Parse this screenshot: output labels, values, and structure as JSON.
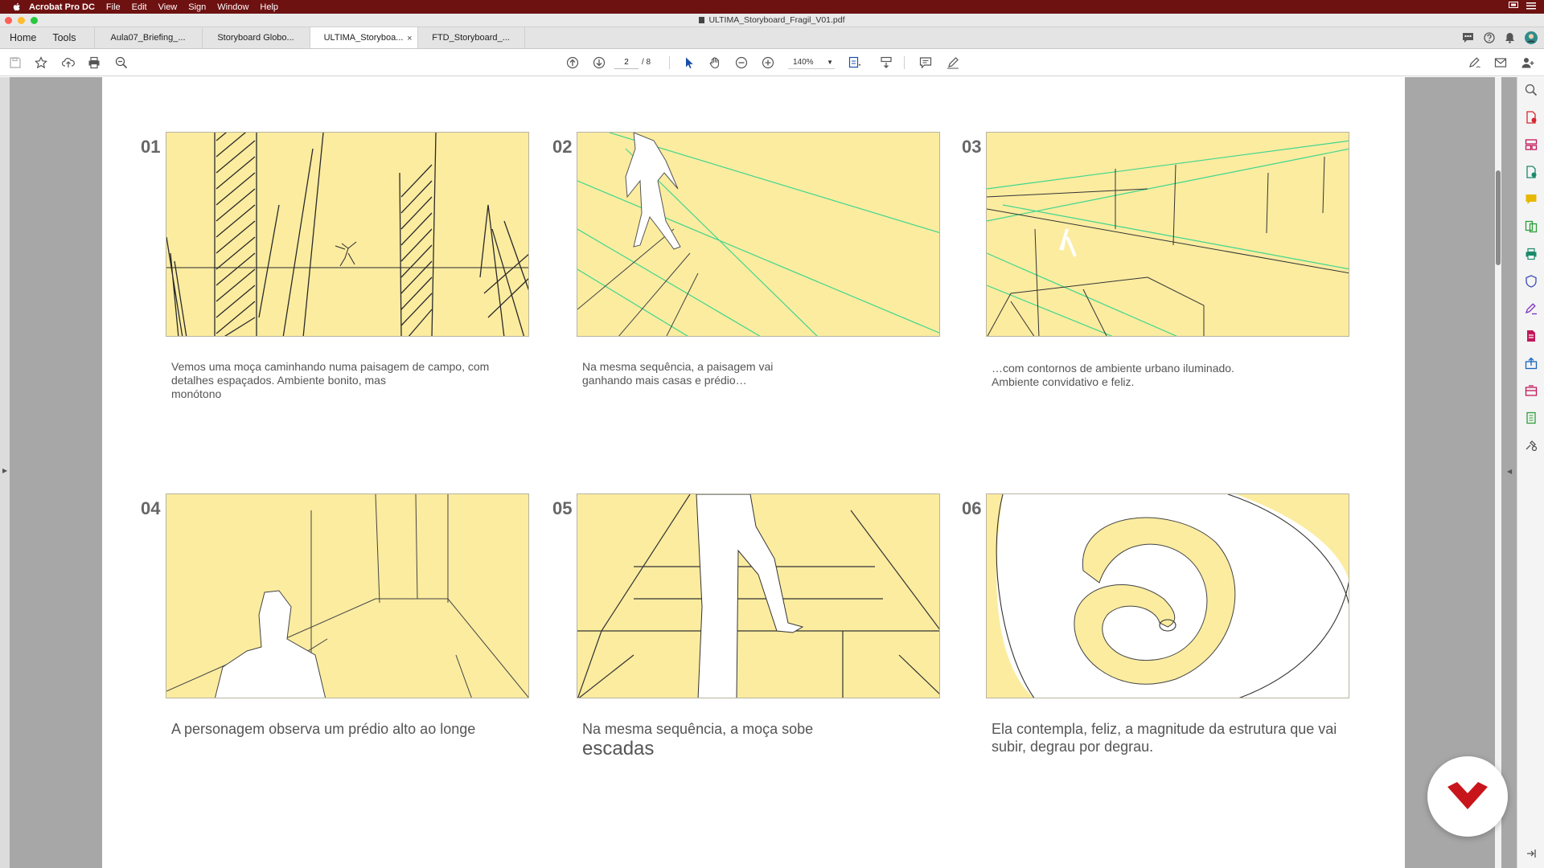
{
  "menubar": {
    "app_name": "Acrobat Pro DC",
    "menus": [
      "File",
      "Edit",
      "View",
      "Sign",
      "Window",
      "Help"
    ]
  },
  "window": {
    "title": "ULTIMA_Storyboard_Fragil_V01.pdf"
  },
  "tabs": {
    "home_label": "Home",
    "tools_label": "Tools",
    "documents": [
      {
        "label": "Aula07_Briefing_..."
      },
      {
        "label": "Storyboard Globo..."
      },
      {
        "label": "ULTIMA_Storyboa...",
        "active": true
      },
      {
        "label": "FTD_Storyboard_..."
      }
    ],
    "close_glyph": "×"
  },
  "toolbar": {
    "current_page": "2",
    "total_pages": "/ 8",
    "zoom": "140%"
  },
  "storyboard": {
    "frame_color": "#fbeca0",
    "panels": [
      {
        "number": "01",
        "caption": "Vemos uma moça caminhando numa paisagem de campo, com\ndetalhes espaçados. Ambiente bonito, mas\nmonótono"
      },
      {
        "number": "02",
        "caption": "Na mesma sequência, a paisagem vai\nganhando mais casas e prédio…"
      },
      {
        "number": "03",
        "caption": "…com contornos de ambiente urbano iluminado.\nAmbiente convidativo e feliz."
      },
      {
        "number": "04",
        "caption": "A personagem observa um prédio alto ao longe"
      },
      {
        "number": "05",
        "caption": "Na mesma sequência, a moça sobe",
        "caption_sub": "escadas"
      },
      {
        "number": "06",
        "caption": "Ela contempla, feliz, a magnitude da estrutura que vai\nsubir, degrau por degrau."
      }
    ]
  },
  "colors": {
    "menubar": "#6e1111",
    "logo_red": "#c8151b",
    "guide_green": "#3fd68c"
  }
}
